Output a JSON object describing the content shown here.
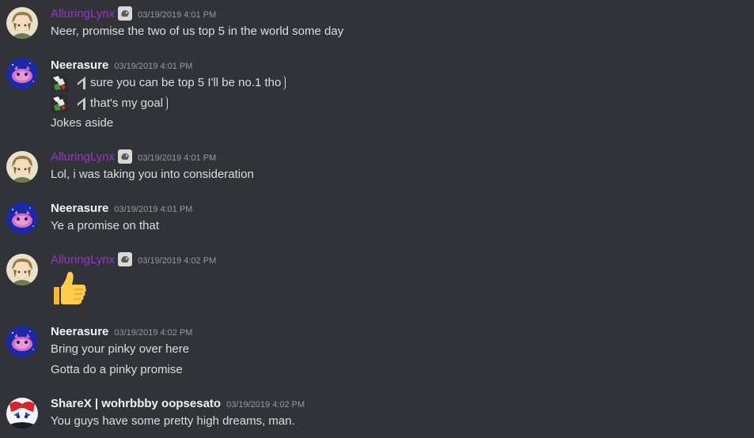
{
  "colors": {
    "background": "#313338",
    "username_role": "#9b33c9",
    "username_default": "#f2f3f5",
    "timestamp": "#949ba4",
    "text": "#dbdee1"
  },
  "messages": [
    {
      "author": "AlluringLynx",
      "timestamp": "03/19/2019 4:01 PM",
      "lines": [
        "Neer, promise the two of us top 5 in the world some day"
      ]
    },
    {
      "author": "Neerasure",
      "timestamp": "03/19/2019 4:01 PM",
      "lines": [
        "sure you can be top 5 I'll be no.1 tho",
        "that's my goal",
        "Jokes aside"
      ]
    },
    {
      "author": "AlluringLynx",
      "timestamp": "03/19/2019 4:01 PM",
      "lines": [
        "Lol, i was taking you into consideration"
      ]
    },
    {
      "author": "Neerasure",
      "timestamp": "03/19/2019 4:01 PM",
      "lines": [
        "Ye a promise on that"
      ]
    },
    {
      "author": "AlluringLynx",
      "timestamp": "03/19/2019 4:02 PM",
      "lines": [],
      "emoji": "thumbs-up"
    },
    {
      "author": "Neerasure",
      "timestamp": "03/19/2019 4:02 PM",
      "lines": [
        "Bring your pinky over here",
        "Gotta do a pinky promise"
      ]
    },
    {
      "author": "ShareX | wohrbbby oopsesato",
      "timestamp": "03/19/2019 4:02 PM",
      "lines": [
        "You guys have some pretty high dreams, man."
      ]
    }
  ]
}
